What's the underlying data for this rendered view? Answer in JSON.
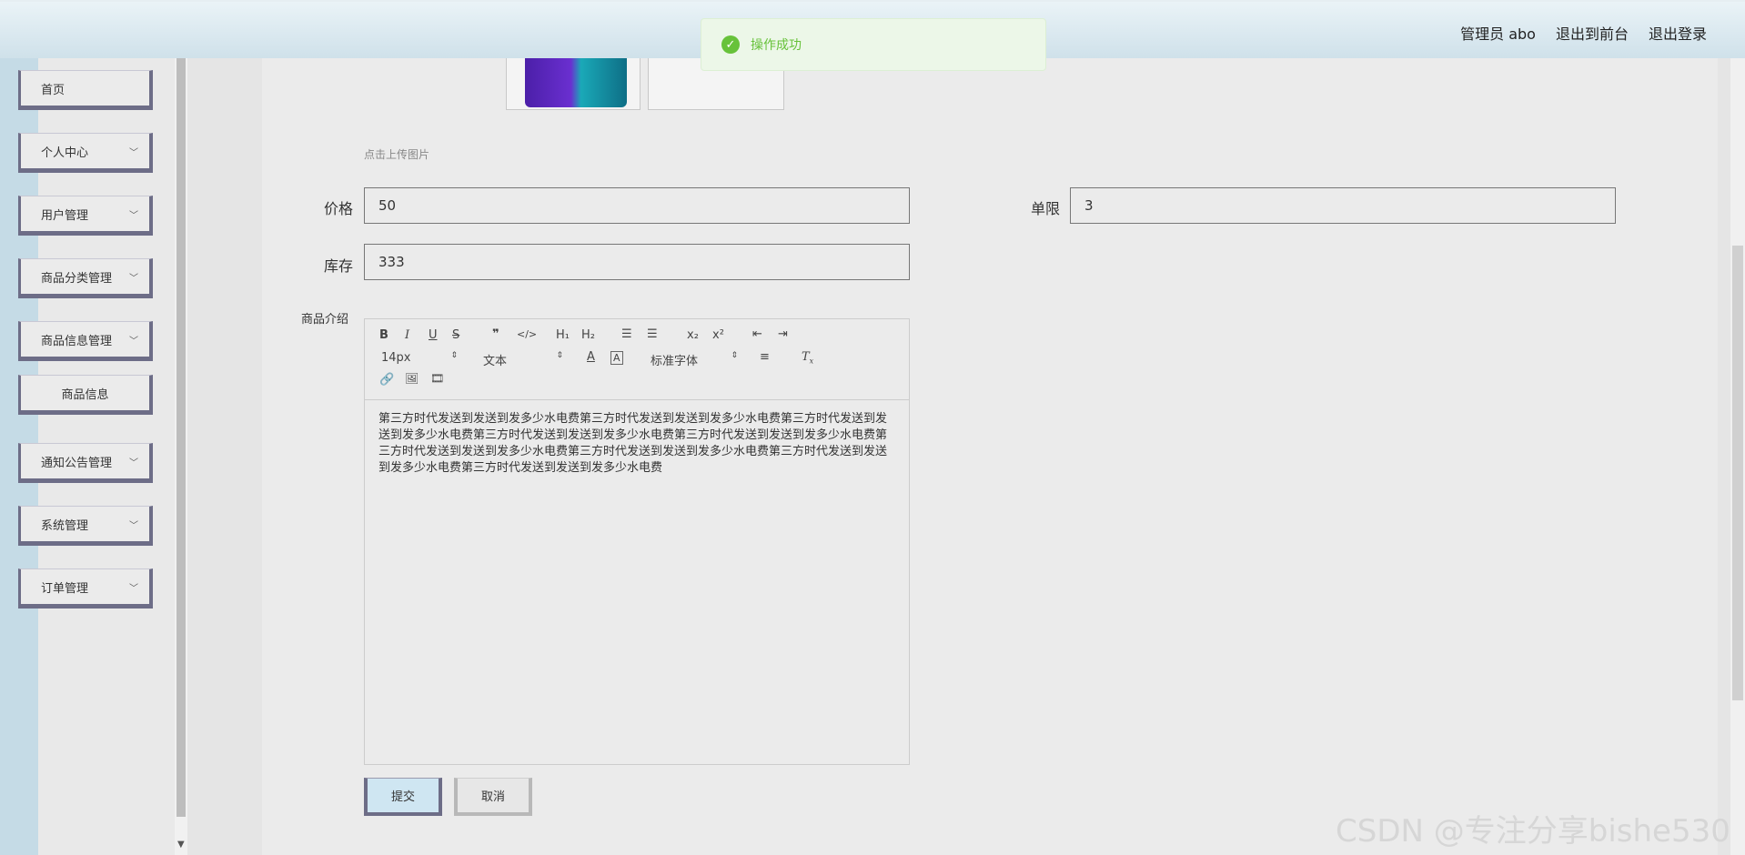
{
  "header": {
    "title": "",
    "user": "管理员 abo",
    "exit_front": "退出到前台",
    "logout": "退出登录"
  },
  "toast": {
    "message": "操作成功"
  },
  "sidebar": {
    "items": [
      {
        "label": "首页"
      },
      {
        "label": "个人中心"
      },
      {
        "label": "用户管理"
      },
      {
        "label": "商品分类管理"
      },
      {
        "label": "商品信息管理"
      },
      {
        "label": "商品信息"
      },
      {
        "label": "通知公告管理"
      },
      {
        "label": "系统管理"
      },
      {
        "label": "订单管理"
      }
    ]
  },
  "form": {
    "upload_hint": "点击上传图片",
    "price_label": "价格",
    "price_value": "50",
    "limit_label": "单限",
    "limit_value": "3",
    "stock_label": "库存",
    "stock_value": "333",
    "desc_label": "商品介绍",
    "font_size": "14px",
    "text_type": "文本",
    "font_family": "标准字体",
    "description": "第三方时代发送到发送到发多少水电费第三方时代发送到发送到发多少水电费第三方时代发送到发送到发多少水电费第三方时代发送到发送到发多少水电费第三方时代发送到发送到发多少水电费第三方时代发送到发送到发多少水电费第三方时代发送到发送到发多少水电费第三方时代发送到发送到发多少水电费第三方时代发送到发送到发多少水电费",
    "submit": "提交",
    "cancel": "取消"
  },
  "watermark": "CSDN @专注分享bishe530"
}
